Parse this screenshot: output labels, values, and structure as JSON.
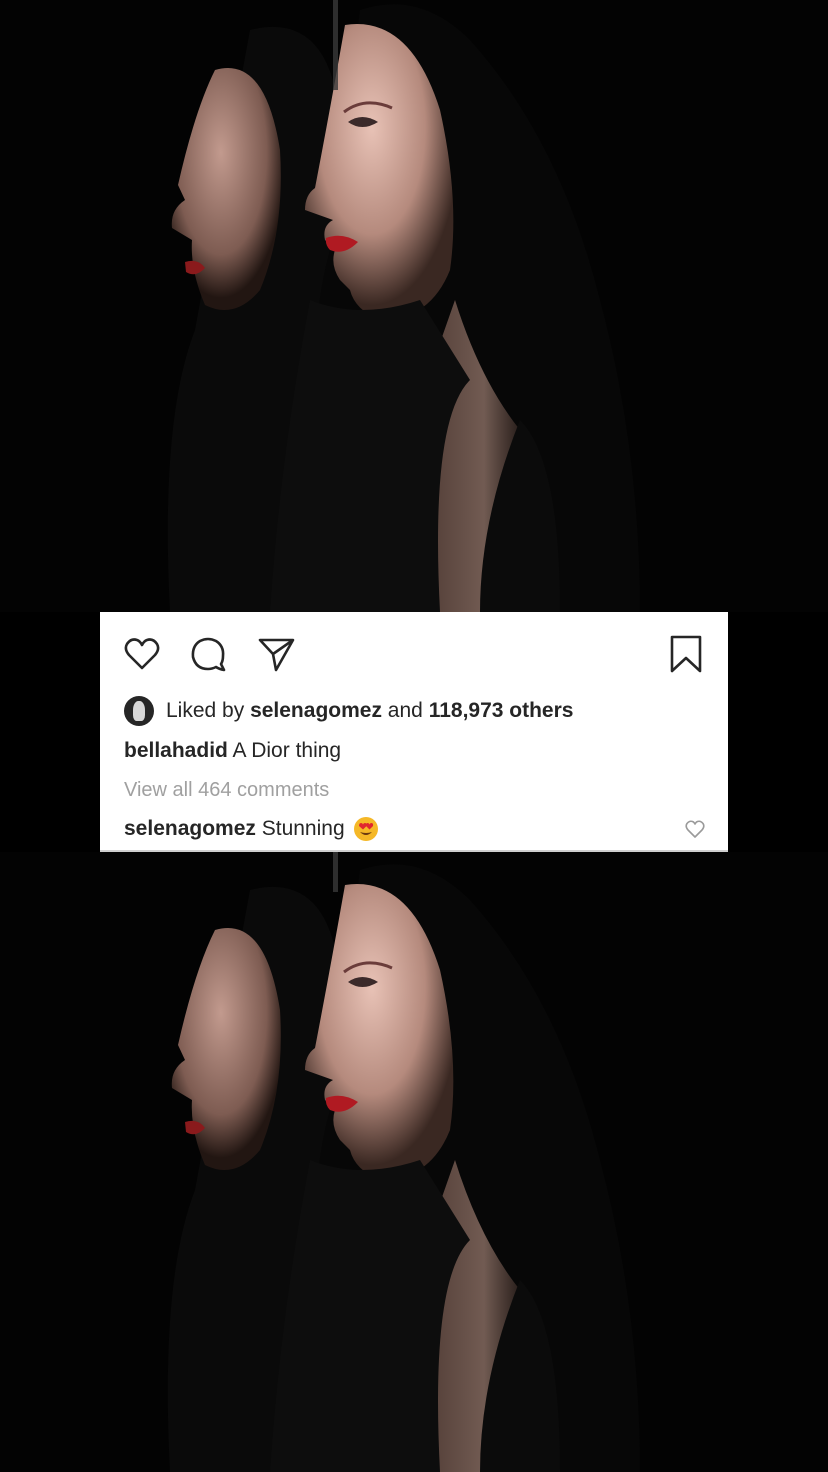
{
  "post": {
    "likes": {
      "prefix": "Liked by",
      "user": "selenagomez",
      "joiner": "and",
      "count_text": "118,973 others"
    },
    "caption": {
      "username": "bellahadid",
      "text": "A Dior thing"
    },
    "view_all_comments": "View all 464 comments",
    "top_comment": {
      "username": "selenagomez",
      "text": "Stunning"
    }
  },
  "icons": {
    "like": "heart-icon",
    "comment": "comment-bubble-icon",
    "share": "paper-plane-icon",
    "save": "bookmark-icon",
    "comment_like": "small-heart-icon",
    "emoji": "heart-eyes-emoji"
  },
  "colors": {
    "background": "#000000",
    "card": "#ffffff",
    "text": "#262626",
    "muted": "#a0a0a0",
    "lips": "#b01a22"
  }
}
